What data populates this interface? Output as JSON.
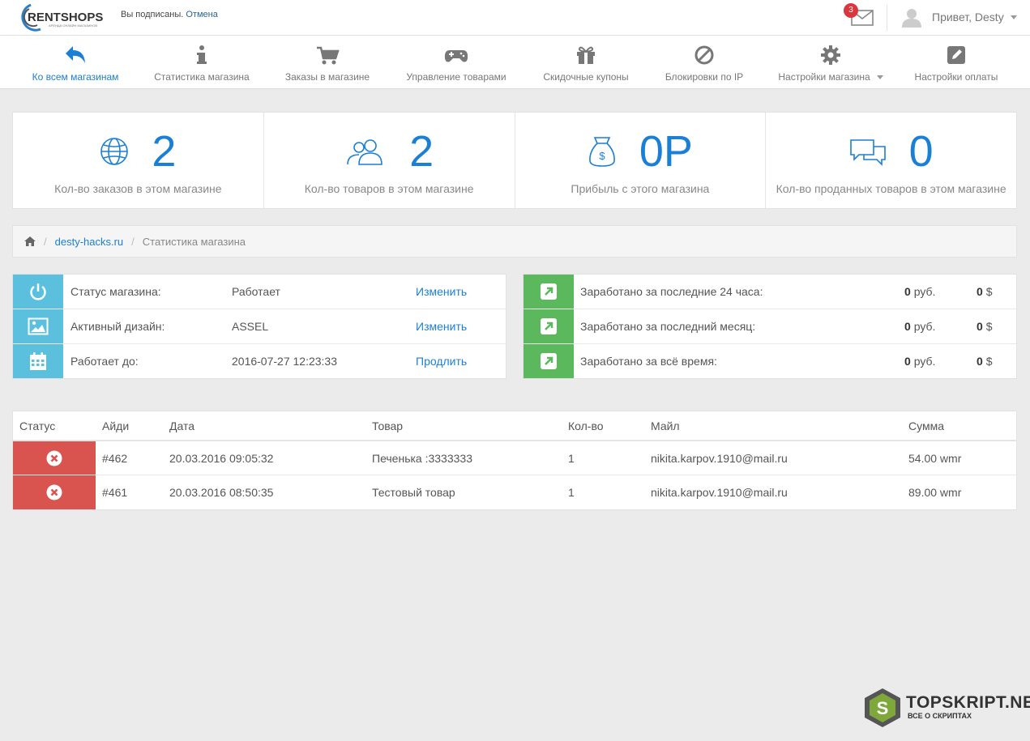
{
  "header": {
    "logo_text": "RENTSHOPS",
    "logo_tagline": "АРЕНДА ОНЛАЙН МАГАЗИНОВ",
    "subscribed_text": "Вы подписаны.",
    "cancel_link": "Отмена",
    "mail_count": "3",
    "greeting": "Привет, Desty"
  },
  "nav": {
    "items": [
      {
        "label": "Ко всем магазинам",
        "icon": "reply-icon",
        "active": true
      },
      {
        "label": "Статистика магазина",
        "icon": "info-icon"
      },
      {
        "label": "Заказы в магазине",
        "icon": "cart-icon"
      },
      {
        "label": "Управление товарами",
        "icon": "gamepad-icon"
      },
      {
        "label": "Скидочные купоны",
        "icon": "gift-icon"
      },
      {
        "label": "Блокировки по IP",
        "icon": "ban-icon"
      },
      {
        "label": "Настройки магазина",
        "icon": "gear-icon",
        "dropdown": true
      },
      {
        "label": "Настройки оплаты",
        "icon": "edit-icon"
      }
    ]
  },
  "stats": [
    {
      "value": "2",
      "caption": "Кол-во заказов в этом магазине",
      "icon": "globe-icon"
    },
    {
      "value": "2",
      "caption": "Кол-во товаров в этом магазине",
      "icon": "users-icon"
    },
    {
      "value": "0Р",
      "caption": "Прибыль с этого магазина",
      "icon": "money-bag-icon"
    },
    {
      "value": "0",
      "caption": "Кол-во проданных товаров в этом магазине",
      "icon": "chat-icon"
    }
  ],
  "breadcrumb": {
    "shop": "desty-hacks.ru",
    "current": "Статистика магазина"
  },
  "shop_info": [
    {
      "label": "Статус магазина:",
      "value": "Работает",
      "action": "Изменить",
      "icon": "power-icon"
    },
    {
      "label": "Активный дизайн:",
      "value": "ASSEL",
      "action": "Изменить",
      "icon": "image-icon"
    },
    {
      "label": "Работает до:",
      "value": "2016-07-27 12:23:33",
      "action": "Продлить",
      "icon": "calendar-icon"
    }
  ],
  "earnings": [
    {
      "label": "Заработано за последние 24 часа:",
      "rub": "0",
      "rub_unit": "руб.",
      "usd": "0",
      "usd_unit": "$"
    },
    {
      "label": "Заработано за последний месяц:",
      "rub": "0",
      "rub_unit": "руб.",
      "usd": "0",
      "usd_unit": "$"
    },
    {
      "label": "Заработано за всё время:",
      "rub": "0",
      "rub_unit": "руб.",
      "usd": "0",
      "usd_unit": "$"
    }
  ],
  "orders": {
    "columns": [
      "Статус",
      "Айди",
      "Дата",
      "Товар",
      "Кол-во",
      "Майл",
      "Сумма"
    ],
    "rows": [
      {
        "id": "#462",
        "date": "20.03.2016 09:05:32",
        "product": "Печенька :3333333",
        "qty": "1",
        "email": "nikita.karpov.1910@mail.ru",
        "sum": "54.00 wmr"
      },
      {
        "id": "#461",
        "date": "20.03.2016 08:50:35",
        "product": "Тестовый товар",
        "qty": "1",
        "email": "nikita.karpov.1910@mail.ru",
        "sum": "89.00 wmr"
      }
    ]
  },
  "watermark": {
    "title": "TOPSKRIPT.NET",
    "subtitle": "ВСЕ О СКРИПТАХ",
    "badge_letter": "S"
  },
  "colors": {
    "accent": "#1b7fd6",
    "info": "#5bc0de",
    "success": "#5cb85c",
    "danger": "#d9534f"
  }
}
